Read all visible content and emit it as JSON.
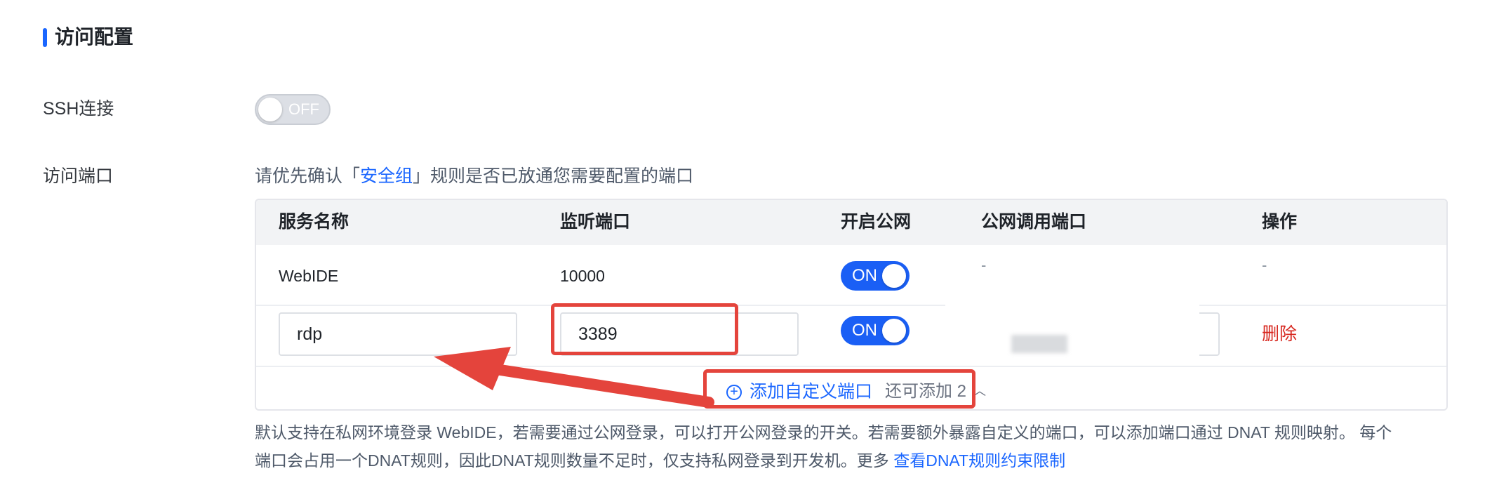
{
  "section": {
    "title": "访问配置"
  },
  "ssh": {
    "label": "SSH连接",
    "toggle": "OFF"
  },
  "ports": {
    "label": "访问端口",
    "hint_prefix": "请优先确认「",
    "hint_link": "安全组",
    "hint_suffix": "」规则是否已放通您需要配置的端口",
    "columns": [
      "服务名称",
      "监听端口",
      "开启公网",
      "公网调用端口",
      "操作"
    ],
    "rows": [
      {
        "name": "WebIDE",
        "port": "10000",
        "public": "ON",
        "public_port": "-",
        "action": "-"
      },
      {
        "name": "rdp",
        "port": "3389",
        "public": "ON",
        "public_port": "",
        "action": "删除"
      }
    ],
    "add_label": "添加自定义端口",
    "add_remaining": "还可添加 2"
  },
  "note": {
    "line1": "默认支持在私网环境登录 WebIDE，若需要通过公网登录，可以打开公网登录的开关。若需要额外暴露自定义的端口，可以添加端口通过 DNAT 规则映射。 每个",
    "line2_prefix": "端口会占用一个DNAT规则，因此DNAT规则数量不足时，仅支持私网登录到开发机。更多 ",
    "link": "查看DNAT规则约束限制"
  },
  "colors": {
    "accent": "#1a66ff",
    "danger": "#d7261e",
    "annotation": "#e4443c"
  },
  "icons": [
    "plus-circle-icon",
    "chevron-up-icon",
    "annotation-arrow-icon"
  ]
}
